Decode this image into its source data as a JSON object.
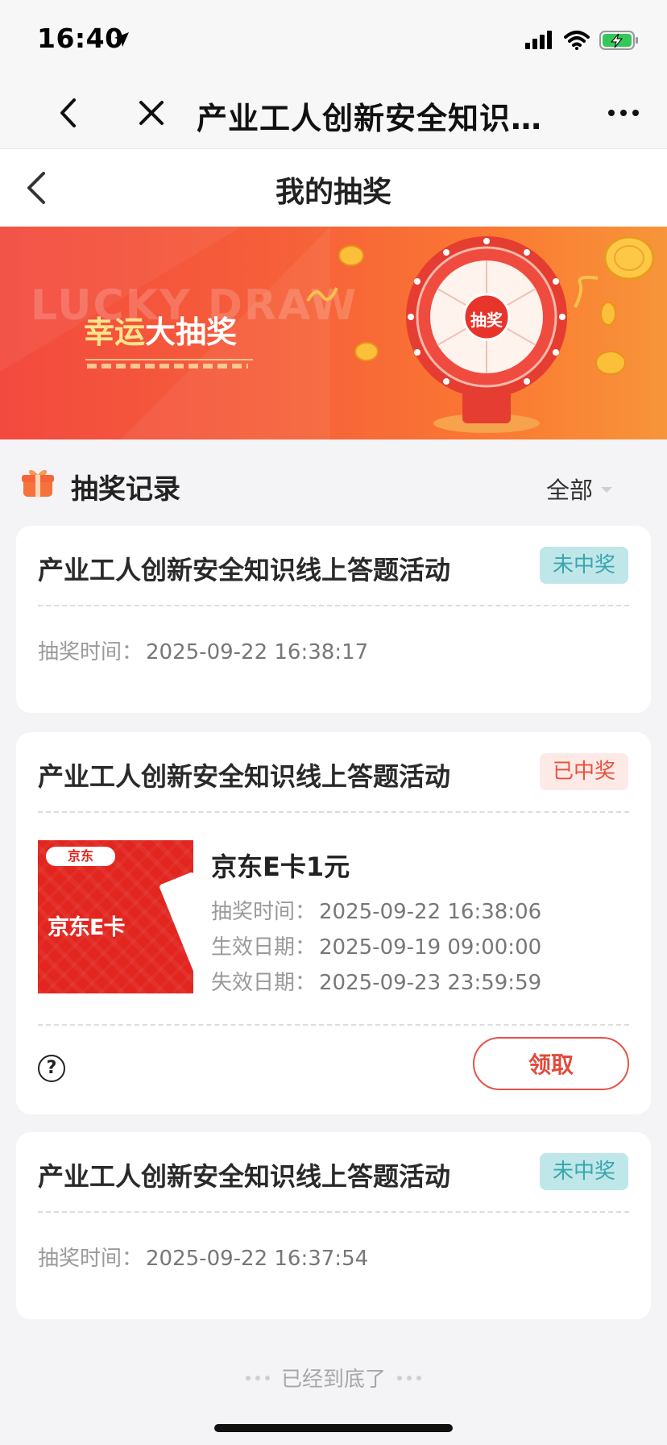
{
  "status_bar": {
    "time": "16:40"
  },
  "wx_nav": {
    "title": "产业工人创新安全知识…"
  },
  "page": {
    "title": "我的抽奖"
  },
  "banner": {
    "bg_text": "LUCKY DRAW",
    "title_part1": "幸运",
    "title_part2": "大抽奖",
    "wheel_center": "抽奖"
  },
  "records": {
    "title": "抽奖记录",
    "filter_label": "全部",
    "items": [
      {
        "title": "产业工人创新安全知识线上答题活动",
        "status": "未中奖",
        "time_label": "抽奖时间：",
        "time_value": "2025-09-22 16:38:17"
      },
      {
        "title": "产业工人创新安全知识线上答题活动",
        "status": "已中奖",
        "prize_brand": "京东",
        "prize_image_text": "京东E卡",
        "prize_name": "京东E卡1元",
        "draw_label": "抽奖时间：",
        "draw_value": "2025-09-22 16:38:06",
        "start_label": "生效日期：",
        "start_value": "2025-09-19 09:00:00",
        "end_label": "失效日期：",
        "end_value": "2025-09-23 23:59:59",
        "help_glyph": "?",
        "claim_label": "领取"
      },
      {
        "title": "产业工人创新安全知识线上答题活动",
        "status": "未中奖",
        "time_label": "抽奖时间：",
        "time_value": "2025-09-22 16:37:54"
      }
    ]
  },
  "footer": {
    "end_text": "已经到底了"
  },
  "colors": {
    "miss_badge_bg": "#bfe7ea",
    "miss_badge_text": "#3aa6ad",
    "win_badge_bg": "#fdeae7",
    "win_badge_text": "#e8513f",
    "claim_button": "#e34a3b",
    "banner_start": "#f34a3f",
    "banner_end": "#f7953a"
  },
  "icons": [
    "location-arrow-icon",
    "signal-icon",
    "wifi-icon",
    "battery-charging-icon",
    "back-chevron-icon",
    "close-icon",
    "more-icon",
    "gift-icon",
    "caret-down-icon",
    "help-icon"
  ]
}
